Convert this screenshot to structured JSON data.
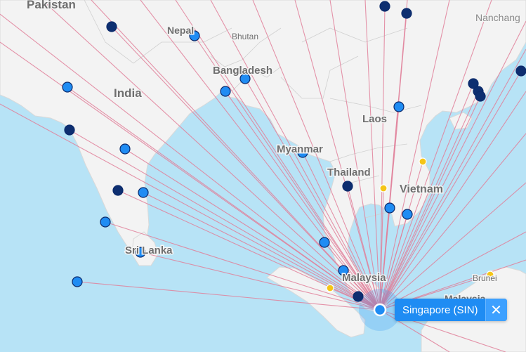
{
  "map": {
    "country_labels": [
      {
        "name": "pakistan-label",
        "text": "Pakistan"
      },
      {
        "name": "nepal-label",
        "text": "Nepal"
      },
      {
        "name": "bhutan-label",
        "text": "Bhutan"
      },
      {
        "name": "bangladesh-label",
        "text": "Bangladesh"
      },
      {
        "name": "india-label",
        "text": "India"
      },
      {
        "name": "laos-label",
        "text": "Laos"
      },
      {
        "name": "myanmar-label",
        "text": "Myanmar"
      },
      {
        "name": "thailand-label",
        "text": "Thailand"
      },
      {
        "name": "vietnam-label",
        "text": "Vietnam"
      },
      {
        "name": "sri-lanka-label",
        "text": "Sri Lanka"
      },
      {
        "name": "malaysia-label",
        "text": "Malaysia"
      },
      {
        "name": "brunei-label",
        "text": "Brunei"
      },
      {
        "name": "malaysia-east-label",
        "text": "Malaysia"
      }
    ],
    "city_labels": [
      {
        "name": "nanchang-label",
        "text": "Nanchang"
      }
    ],
    "route_color": "#e0809a",
    "hub": {
      "code": "SIN",
      "color": "#1f8cf3"
    },
    "dot_colors": {
      "primary": "#1f8cf3",
      "secondary": "#0d2e70",
      "partner": "#f5c518"
    }
  },
  "popup": {
    "label": "Singapore (SIN)",
    "close_icon": "close-icon",
    "close_glyph": "✕"
  }
}
